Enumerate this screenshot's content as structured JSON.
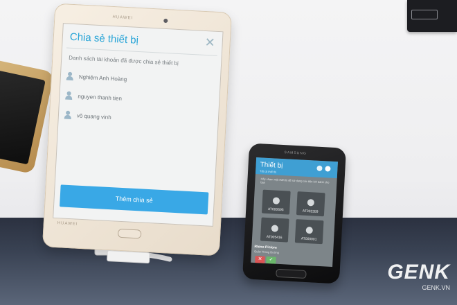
{
  "tablet": {
    "brand": "HUAWEI",
    "screen": {
      "title": "Chia sẻ thiết bị",
      "close_glyph": "✕",
      "subtitle": "Danh sách tài khoản đã được chia sẻ thiết bị",
      "users": [
        "Nghiêm Anh Hoàng",
        "nguyen thanh tien",
        "võ quang vinh"
      ],
      "add_button_label": "Thêm chia sẻ"
    }
  },
  "phone": {
    "brand": "SAMSUNG",
    "screen": {
      "title": "Thiết bị",
      "header_sub": "Tất cả thiết bị",
      "hint": "Hãy chạm một thiết bị để sử dụng các tiện ích dành cho bạn",
      "devices": [
        "AT000695",
        "AT002289",
        "AT005416",
        "AT000001"
      ],
      "rhino_name": "Rhino Pinlore",
      "rhino_sub": "Quản Thùng Đường"
    }
  },
  "watermark": {
    "logo": "GENK",
    "url": "GENK.VN"
  },
  "colors": {
    "tablet_accent": "#27a4d7",
    "button_blue": "#39a8e6",
    "phone_header": "#3f9fd3"
  }
}
